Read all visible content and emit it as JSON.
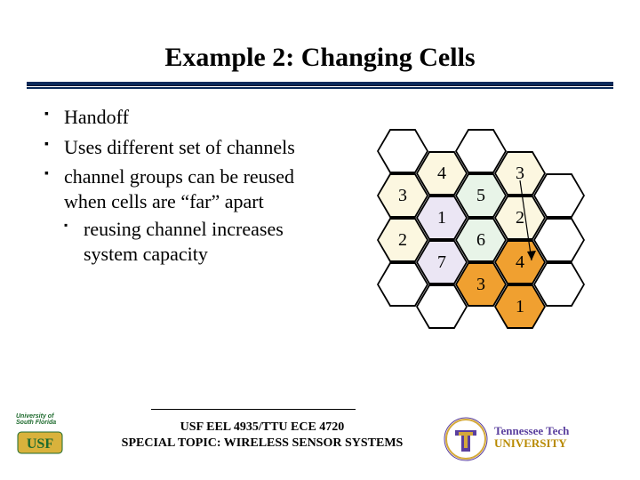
{
  "title": "Example 2: Changing Cells",
  "bullets": {
    "b1": "Handoff",
    "b2": "Uses different set of channels",
    "b3": "channel groups can be reused when cells are “far” apart",
    "b3a": "reusing channel increases system capacity"
  },
  "cells": {
    "r0c1": "4",
    "r0c3": "3",
    "r1c0": "3",
    "r1c2": "5",
    "r2c1": "1",
    "r2c3": "2",
    "r3c0": "2",
    "r3c2": "6",
    "r4c1": "7",
    "r4c3": "4",
    "r5c2": "3",
    "r6c3": "1"
  },
  "footer": {
    "line1": "USF EEL 4935/TTU ECE 4720",
    "line2": "SPECIAL TOPIC: WIRELESS SENSOR SYSTEMS"
  },
  "ttu": {
    "line1": "Tennessee Tech",
    "line2": "UNIVERSITY"
  },
  "usf": {
    "line1": "University of",
    "line2": "South Florida"
  }
}
